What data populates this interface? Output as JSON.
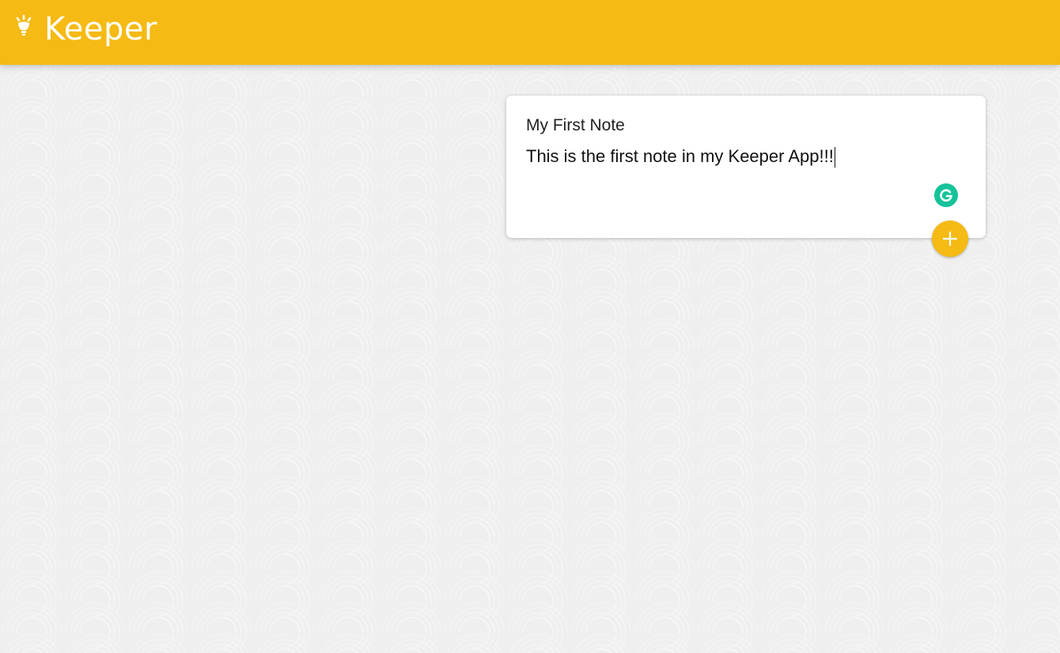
{
  "header": {
    "title": "Keeper",
    "logo_icon": "lightbulb-icon",
    "background_color": "#f5ba13"
  },
  "note_form": {
    "title_value": "My First Note",
    "content_value": "This is the first note in my Keeper App!!!",
    "add_button_icon": "plus-icon",
    "add_button_color": "#f5ba13",
    "extension_icon": "grammarly-icon",
    "extension_icon_color": "#15c39a"
  }
}
